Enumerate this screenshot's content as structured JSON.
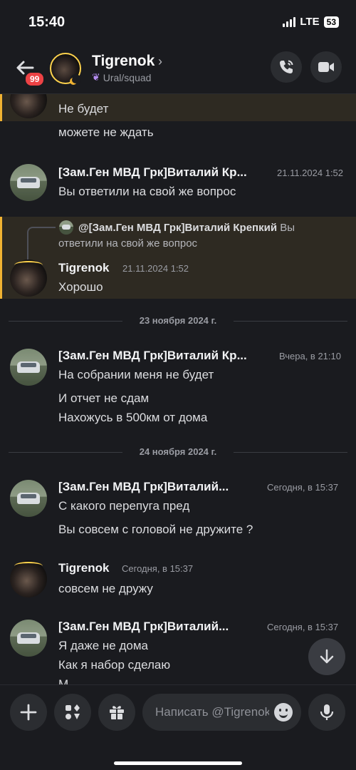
{
  "status": {
    "time": "15:40",
    "network": "LTE",
    "battery": "53"
  },
  "header": {
    "back_badge": "99",
    "title": "Tigrenok",
    "chevron": "›",
    "subtitle": "Ural/squad",
    "subtitle_icon": "butterfly-icon"
  },
  "messages": {
    "m1": {
      "line1": "Не будет",
      "line2": "можете не ждать"
    },
    "m2": {
      "author": "[Зам.Ген МВД Грк]Виталий Кр...",
      "time": "21.11.2024 1:52",
      "text": "Вы ответили на свой же вопрос"
    },
    "m3": {
      "reply_author": "@[Зам.Ген МВД Грк]Виталий Крепкий",
      "reply_text_1": "Вы",
      "reply_text_2": "ответили на свой же вопрос",
      "author": "Tigrenok",
      "time": "21.11.2024 1:52",
      "text": "Хорошо"
    },
    "divider1": "23 ноября 2024 г.",
    "m4": {
      "author": "[Зам.Ген МВД Грк]Виталий Кр...",
      "time": "Вчера, в 21:10",
      "line1": "На собрании меня не будет",
      "line2": "И отчет не сдам",
      "line3": "Нахожусь в 500км от дома"
    },
    "divider2": "24 ноября 2024 г.",
    "m5": {
      "author": "[Зам.Ген МВД Грк]Виталий...",
      "time": "Сегодня, в 15:37",
      "line1": "С какого перепуга пред",
      "line2": "Вы совсем с головой не дружите ?"
    },
    "m6": {
      "author": "Tigrenok",
      "time": "Сегодня, в 15:37",
      "text": "совсем не дружу"
    },
    "m7": {
      "author": "[Зам.Ген МВД Грк]Виталий...",
      "time": "Сегодня, в 15:37",
      "line1": "Я даже не дома",
      "line2": "Как я набор сделаю",
      "line3": "М"
    }
  },
  "composer": {
    "placeholder": "Написать @Tigrenok"
  },
  "colors": {
    "background": "#1a1b1f",
    "highlight": "#2e2a22",
    "highlight_bar": "#f0b232",
    "badge": "#ed4245"
  }
}
